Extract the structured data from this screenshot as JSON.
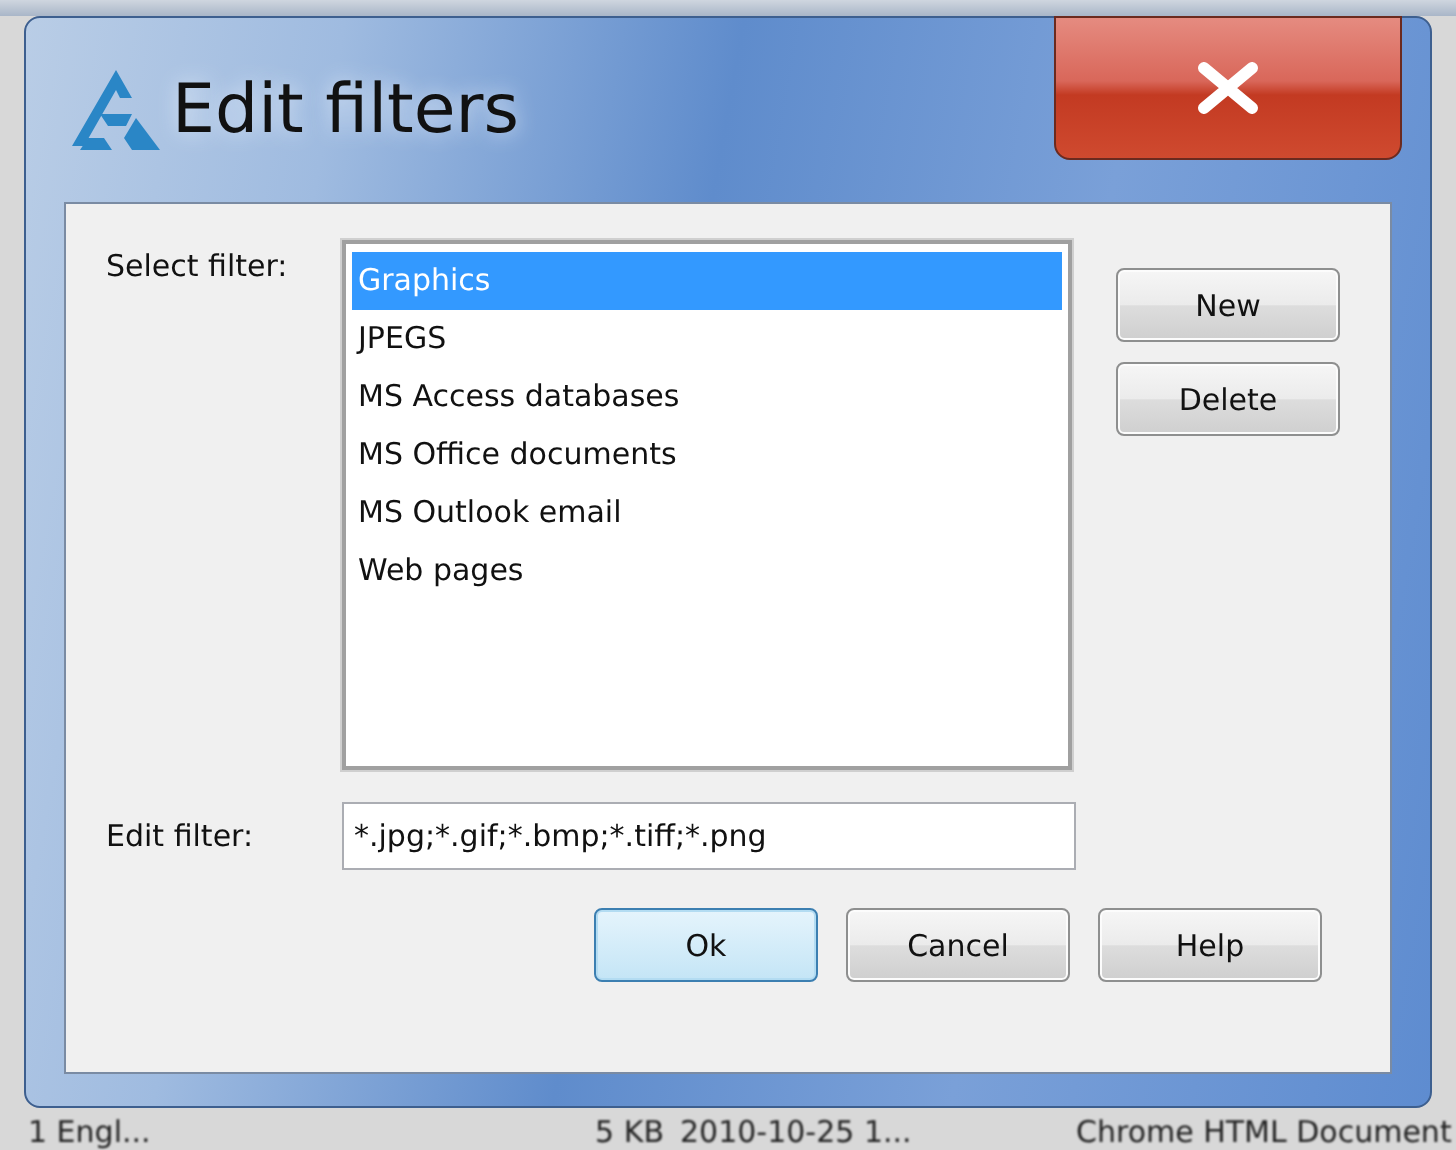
{
  "window": {
    "title": "Edit filters"
  },
  "select_filter": {
    "label": "Select filter:",
    "items": [
      {
        "label": "Graphics",
        "selected": true
      },
      {
        "label": "JPEGS",
        "selected": false
      },
      {
        "label": "MS Access databases",
        "selected": false
      },
      {
        "label": "MS Office documents",
        "selected": false
      },
      {
        "label": "MS Outlook email",
        "selected": false
      },
      {
        "label": "Web pages",
        "selected": false
      }
    ]
  },
  "side_buttons": [
    {
      "label": "New"
    },
    {
      "label": "Delete"
    }
  ],
  "edit_filter": {
    "label": "Edit filter:",
    "value": "*.jpg;*.gif;*.bmp;*.tiff;*.png"
  },
  "buttons": [
    {
      "label": "Ok",
      "default": true
    },
    {
      "label": "Cancel",
      "default": false
    },
    {
      "label": "Help",
      "default": false
    }
  ],
  "background_row": {
    "cells": [
      "1 Engl...",
      "5 KB",
      "2010-10-25 1...",
      "Chrome HTML Document"
    ]
  }
}
